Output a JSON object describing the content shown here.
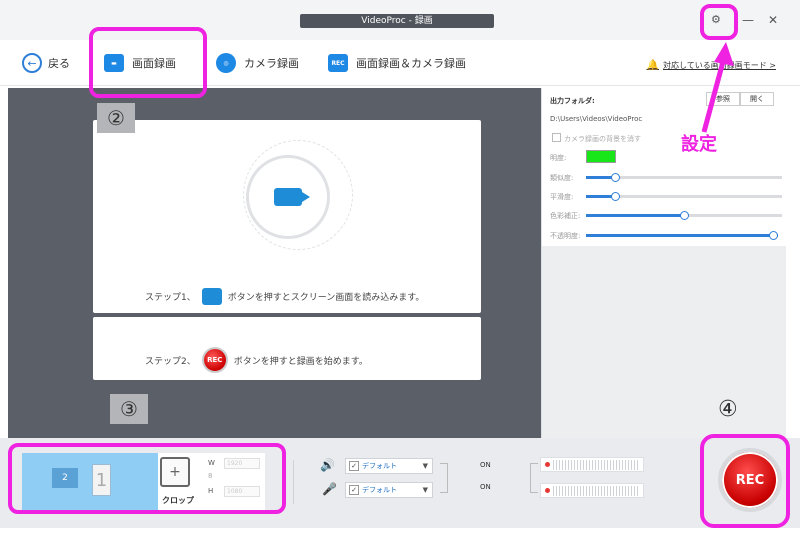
{
  "window": {
    "title": "VideoProc - 録画",
    "minimize": "—",
    "close": "✕"
  },
  "nav": {
    "back_label": "戻る",
    "tabs": [
      {
        "label": "画面録画",
        "icon": "screen-record-icon"
      },
      {
        "label": "カメラ録画",
        "icon": "camera-icon"
      },
      {
        "label": "画面録画＆カメラ録画",
        "icon": "rec-icon",
        "icon_text": "REC"
      }
    ],
    "hardware_link": "対応している画面録画モード >"
  },
  "preview": {
    "step1": {
      "prefix": "ステップ1、",
      "text": "ボタンを押すとスクリーン画面を読み込みます。"
    },
    "step2": {
      "prefix": "ステップ2、",
      "text": "ボタンを押すと録画を始めます。",
      "rec_icon_text": "REC"
    }
  },
  "settings": {
    "output_folder_label": "出力フォルダ:",
    "browse_button": "参照",
    "open_button": "開く",
    "folder_path": "D:\\Users\\Videos\\VideoProc",
    "camera_bg_label": "カメラ録画の背景を消す",
    "brightness_label": "明度:",
    "brightness_color": "#19e619",
    "sliders": [
      {
        "label": "類似度:",
        "value": 0.15
      },
      {
        "label": "平滑度:",
        "value": 0.15
      },
      {
        "label": "色彩補正:",
        "value": 0.5
      },
      {
        "label": "不透明度:",
        "value": 1.0
      }
    ]
  },
  "bottom": {
    "monitor_small": "2",
    "monitor_large": "1",
    "crop_label": "クロップ",
    "crop_icon": "crop-icon",
    "width_key": "W",
    "width_value": "1920",
    "height_key": "H",
    "height_value": "1080",
    "link_glyph": "8",
    "audio": [
      {
        "icon": "speaker-icon",
        "device": "デフォルト",
        "status": "ON"
      },
      {
        "icon": "microphone-icon",
        "device": "デフォルト",
        "status": "ON"
      }
    ],
    "rec_button": "REC"
  },
  "annotations": {
    "marker_2": "②",
    "marker_3": "③",
    "marker_4": "④",
    "settings_label": "設定",
    "highlight_color": "#ee22e0"
  }
}
